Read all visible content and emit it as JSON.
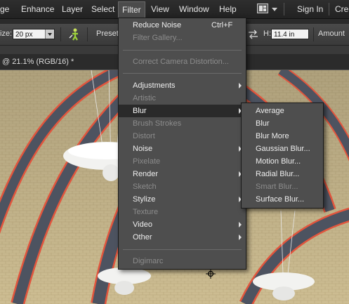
{
  "menubar": {
    "items": [
      "ge",
      "Enhance",
      "Layer",
      "Select",
      "Filter",
      "View",
      "Window",
      "Help"
    ],
    "sign_in": "Sign In",
    "create": "Crea"
  },
  "options": {
    "size_label": "ize:",
    "size_value": "20 px",
    "preset_label": "Preset:",
    "h_label": "H:",
    "h_value": "11.4 in",
    "amount_label": "Amount"
  },
  "document_tab": "@ 21.1% (RGB/16) *",
  "filter_menu": {
    "items": [
      {
        "label": "Reduce Noise",
        "shortcut": "Ctrl+F",
        "enabled": true,
        "submenu": false
      },
      {
        "label": "Filter Gallery...",
        "enabled": false,
        "submenu": false
      },
      {
        "label": "Correct Camera Distortion...",
        "enabled": false,
        "submenu": false
      },
      {
        "label": "Adjustments",
        "enabled": true,
        "submenu": true
      },
      {
        "label": "Artistic",
        "enabled": false,
        "submenu": false
      },
      {
        "label": "Blur",
        "enabled": true,
        "submenu": true,
        "highlighted": true
      },
      {
        "label": "Brush Strokes",
        "enabled": false,
        "submenu": false
      },
      {
        "label": "Distort",
        "enabled": false,
        "submenu": false
      },
      {
        "label": "Noise",
        "enabled": true,
        "submenu": true
      },
      {
        "label": "Pixelate",
        "enabled": false,
        "submenu": false
      },
      {
        "label": "Render",
        "enabled": true,
        "submenu": true
      },
      {
        "label": "Sketch",
        "enabled": false,
        "submenu": false
      },
      {
        "label": "Stylize",
        "enabled": true,
        "submenu": true
      },
      {
        "label": "Texture",
        "enabled": false,
        "submenu": false
      },
      {
        "label": "Video",
        "enabled": true,
        "submenu": true
      },
      {
        "label": "Other",
        "enabled": true,
        "submenu": true
      },
      {
        "label": "Digimarc",
        "enabled": false,
        "submenu": false
      }
    ]
  },
  "blur_submenu": {
    "items": [
      {
        "label": "Average",
        "enabled": true
      },
      {
        "label": "Blur",
        "enabled": true
      },
      {
        "label": "Blur More",
        "enabled": true
      },
      {
        "label": "Gaussian Blur...",
        "enabled": true
      },
      {
        "label": "Motion Blur...",
        "enabled": true
      },
      {
        "label": "Radial Blur...",
        "enabled": true
      },
      {
        "label": "Smart Blur...",
        "enabled": false
      },
      {
        "label": "Surface Blur...",
        "enabled": true
      }
    ]
  },
  "icons": {
    "workspace": "workspace-layout-icon",
    "dropdown": "chevron-down-icon",
    "brush": "brush-figure-icon",
    "swap": "swap-arrows-icon",
    "cursor": "crosshair-cursor-icon"
  },
  "colors": {
    "menu_bg": "#4e4e4e",
    "menu_highlight": "#2a2a2a",
    "disabled_text": "#8c8c8c",
    "active_menu_border": "#6a6a6a"
  }
}
